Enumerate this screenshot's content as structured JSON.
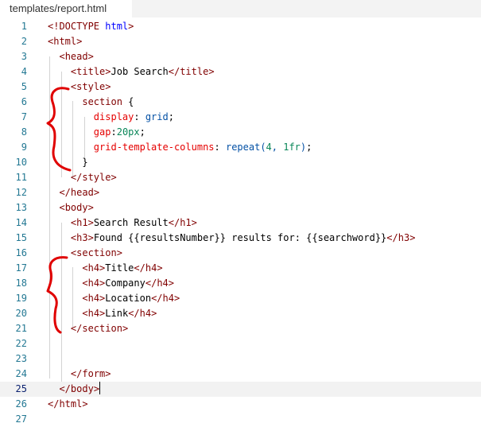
{
  "tab": {
    "label": "templates/report.html"
  },
  "lines": [
    {
      "n": "1",
      "code": "<!DOCTYPE html>"
    },
    {
      "n": "2",
      "code": "<html>"
    },
    {
      "n": "3",
      "code": "  <head>"
    },
    {
      "n": "4",
      "code": "    <title>Job Search</title>"
    },
    {
      "n": "5",
      "code": "    <style>"
    },
    {
      "n": "6",
      "code": "      section {"
    },
    {
      "n": "7",
      "code": "        display: grid;"
    },
    {
      "n": "8",
      "code": "        gap:20px;"
    },
    {
      "n": "9",
      "code": "        grid-template-columns: repeat(4, 1fr);"
    },
    {
      "n": "10",
      "code": "      }"
    },
    {
      "n": "11",
      "code": "    </style>"
    },
    {
      "n": "12",
      "code": "  </head>"
    },
    {
      "n": "13",
      "code": "  <body>"
    },
    {
      "n": "14",
      "code": "    <h1>Search Result</h1>"
    },
    {
      "n": "15",
      "code": "    <h3>Found {{resultsNumber}} results for: {{searchword}}</h3>"
    },
    {
      "n": "16",
      "code": "    <section>"
    },
    {
      "n": "17",
      "code": "      <h4>Title</h4>"
    },
    {
      "n": "18",
      "code": "      <h4>Company</h4>"
    },
    {
      "n": "19",
      "code": "      <h4>Location</h4>"
    },
    {
      "n": "20",
      "code": "      <h4>Link</h4>"
    },
    {
      "n": "21",
      "code": "    </section>"
    },
    {
      "n": "22",
      "code": ""
    },
    {
      "n": "23",
      "code": ""
    },
    {
      "n": "24",
      "code": "    </form>"
    },
    {
      "n": "25",
      "code": "  </body>"
    },
    {
      "n": "26",
      "code": "</html>"
    },
    {
      "n": "27",
      "code": ""
    }
  ],
  "current_line": "25",
  "colors": {
    "tag": "#800000",
    "keyword": "#0000ff",
    "css_property": "#e50000",
    "css_value": "#0451a5",
    "number": "#098658",
    "line_number": "#237893",
    "annotation": "#e00000"
  }
}
